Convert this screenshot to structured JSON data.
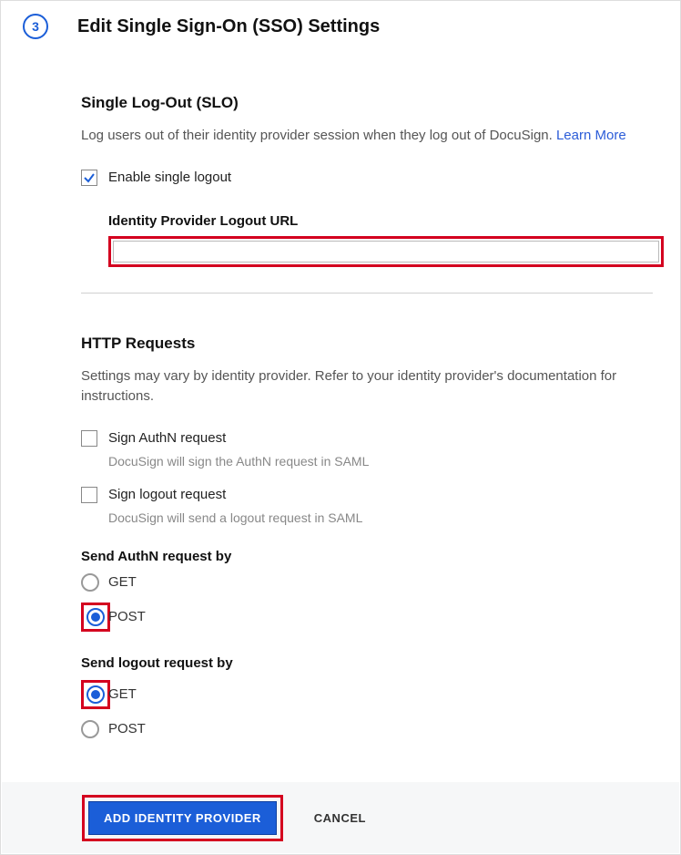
{
  "step": "3",
  "title": "Edit Single Sign-On (SSO) Settings",
  "slo": {
    "heading": "Single Log-Out (SLO)",
    "desc": "Log users out of their identity provider session when they log out of DocuSign. ",
    "learn_more": "Learn More",
    "enable_label": "Enable single logout",
    "enable_checked": true,
    "logout_url_label": "Identity Provider Logout URL",
    "logout_url_value": ""
  },
  "http": {
    "heading": "HTTP Requests",
    "desc": "Settings may vary by identity provider. Refer to your identity provider's documentation for instructions.",
    "sign_authn": {
      "label": "Sign AuthN request",
      "checked": false,
      "hint": "DocuSign will sign the AuthN request in SAML"
    },
    "sign_logout": {
      "label": "Sign logout request",
      "checked": false,
      "hint": "DocuSign will send a logout request in SAML"
    },
    "send_authn": {
      "label": "Send AuthN request by",
      "options": {
        "get": "GET",
        "post": "POST"
      },
      "selected": "post"
    },
    "send_logout": {
      "label": "Send logout request by",
      "options": {
        "get": "GET",
        "post": "POST"
      },
      "selected": "get"
    }
  },
  "footer": {
    "primary": "ADD IDENTITY PROVIDER",
    "cancel": "CANCEL"
  }
}
